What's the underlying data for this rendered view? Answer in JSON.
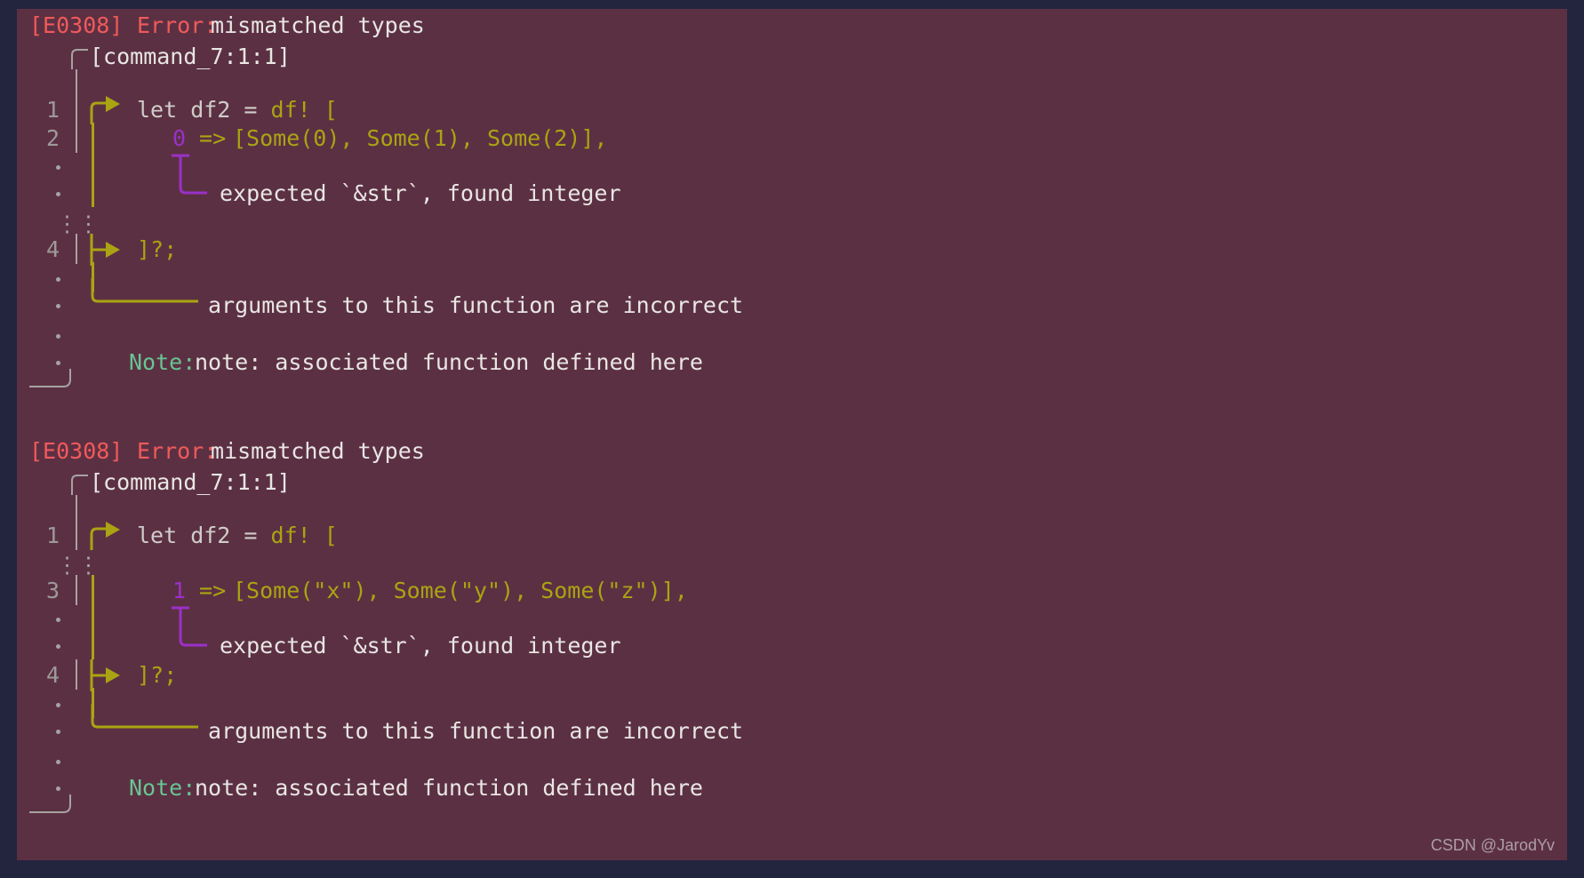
{
  "terminal": {
    "background": "#5c3043",
    "border_background": "#23253f",
    "watermark": "CSDN @JarodYv"
  },
  "colors": {
    "error_code": "#f05a5a",
    "error_label": "#f05a5a",
    "message": "#e8e6e3",
    "gutter": "#a6a3a0",
    "rail": "#aaa412",
    "literal": "#aaa412",
    "number": "#9b30c9",
    "underline": "#9b30c9",
    "note": "#68c493",
    "code": "#cfcdc8"
  },
  "icons": {
    "arrow_marker": "play-triangle-icon",
    "branch_marker": "tee-branch-icon",
    "corner_marker": "rounded-corner-icon",
    "underline_marker": "tee-underline-icon",
    "close_bracket": "bracket-close-icon"
  },
  "blocks": [
    {
      "error_code": "[E0308]",
      "error_label": "Error:",
      "error_message": "mismatched types",
      "location": "[command_7:1:1]",
      "code_lines": [
        {
          "number": "1",
          "marker": "arrow",
          "text": "let df2 = df! ["
        },
        {
          "number": "2",
          "marker": "bar",
          "text": "        0 => [Some(0), Some(1), Some(2)],"
        },
        {
          "number": "·",
          "marker": "bar",
          "text": ""
        },
        {
          "number": "·",
          "marker": "bar",
          "text": "expected `&str`, found integer"
        },
        {
          "number": ":",
          "marker": "ellipsis",
          "text": ""
        },
        {
          "number": "4",
          "marker": "branch",
          "text": "]?;"
        },
        {
          "number": "·",
          "marker": "bar",
          "text": ""
        },
        {
          "number": "·",
          "marker": "elbow",
          "text": "arguments to this function are incorrect"
        },
        {
          "number": "·",
          "marker": "none",
          "text": ""
        },
        {
          "number": "·",
          "marker": "none",
          "text": ""
        }
      ],
      "inline_label": "expected `&str`, found integer",
      "span_label": "arguments to this function are incorrect",
      "note_label": "Note:",
      "note_text": "note: associated function defined here",
      "code_tokens": {
        "keyword": "let df2 = ",
        "macro": "df!",
        "open_bracket": " [",
        "index": "0",
        "arrow": " => ",
        "array": "[Some(0), Some(1), Some(2)],",
        "close": "]?;"
      }
    },
    {
      "error_code": "[E0308]",
      "error_label": "Error:",
      "error_message": "mismatched types",
      "location": "[command_7:1:1]",
      "code_lines": [
        {
          "number": "1",
          "marker": "arrow",
          "text": "let df2 = df! ["
        },
        {
          "number": ":",
          "marker": "ellipsis",
          "text": ""
        },
        {
          "number": "3",
          "marker": "bar",
          "text": "        1 => [Some(\"x\"), Some(\"y\"), Some(\"z\")],"
        },
        {
          "number": "·",
          "marker": "bar",
          "text": ""
        },
        {
          "number": "·",
          "marker": "bar",
          "text": "expected `&str`, found integer"
        },
        {
          "number": "4",
          "marker": "branch",
          "text": "]?;"
        },
        {
          "number": "·",
          "marker": "bar",
          "text": ""
        },
        {
          "number": "·",
          "marker": "elbow",
          "text": "arguments to this function are incorrect"
        },
        {
          "number": "·",
          "marker": "none",
          "text": ""
        },
        {
          "number": "·",
          "marker": "none",
          "text": ""
        }
      ],
      "inline_label": "expected `&str`, found integer",
      "span_label": "arguments to this function are incorrect",
      "note_label": "Note:",
      "note_text": "note: associated function defined here",
      "code_tokens": {
        "keyword": "let df2 = ",
        "macro": "df!",
        "open_bracket": " [",
        "index": "1",
        "arrow": " => ",
        "array": "[Some(\"x\"), Some(\"y\"), Some(\"z\")],",
        "close": "]?;"
      }
    }
  ]
}
